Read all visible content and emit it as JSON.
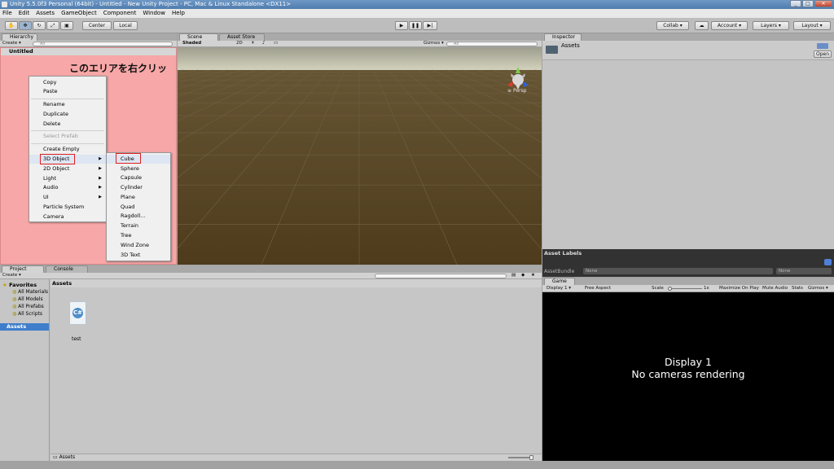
{
  "window": {
    "title": "Unity 5.5.0f3 Personal (64bit) - Untitled - New Unity Project - PC, Mac & Linux Standalone <DX11>"
  },
  "menubar": [
    "File",
    "Edit",
    "Assets",
    "GameObject",
    "Component",
    "Window",
    "Help"
  ],
  "toolbar": {
    "pivot": "Center",
    "space": "Local",
    "collab": "Collab",
    "account": "Account",
    "layers": "Layers",
    "layout": "Layout"
  },
  "hierarchy": {
    "tab": "Hierarchy",
    "create": "Create",
    "search_placeholder": "All",
    "scene_name": "Untitled",
    "annotation": "このエリアを右クリック"
  },
  "context_menu": {
    "items": [
      "Copy",
      "Paste",
      "Rename",
      "Duplicate",
      "Delete",
      "Select Prefab",
      "Create Empty",
      "3D Object",
      "2D Object",
      "Light",
      "Audio",
      "UI",
      "Particle System",
      "Camera"
    ],
    "submenu": [
      "Cube",
      "Sphere",
      "Capsule",
      "Cylinder",
      "Plane",
      "Quad",
      "Ragdoll...",
      "Terrain",
      "Tree",
      "Wind Zone",
      "3D Text"
    ]
  },
  "scene": {
    "tab_scene": "Scene",
    "tab_store": "Asset Store",
    "shading": "Shaded",
    "mode2d": "2D",
    "gizmos": "Gizmos",
    "search": "All",
    "persp": "Persp",
    "colors": {
      "sky": "#c8c8b4",
      "ground": "#4e3d1e"
    }
  },
  "inspector": {
    "tab": "Inspector",
    "name": "Assets",
    "open": "Open"
  },
  "asset_labels": {
    "title": "Asset Labels",
    "bundle_label": "AssetBundle",
    "bundle_value": "None",
    "variant_value": "None"
  },
  "project": {
    "tab_project": "Project",
    "tab_console": "Console",
    "create": "Create",
    "favorites": "Favorites",
    "favorites_items": [
      "All Materials",
      "All Models",
      "All Prefabs",
      "All Scripts"
    ],
    "assets_root": "Assets",
    "breadcrumb": "Assets",
    "file_name": "test",
    "footer_path": "Assets"
  },
  "game": {
    "tab": "Game",
    "display": "Display 1",
    "aspect": "Free Aspect",
    "scale_label": "Scale",
    "scale_value": "1x",
    "maximize": "Maximize On Play",
    "mute": "Mute Audio",
    "stats": "Stats",
    "gizmos": "Gizmos",
    "message_line1": "Display 1",
    "message_line2": "No cameras rendering"
  }
}
